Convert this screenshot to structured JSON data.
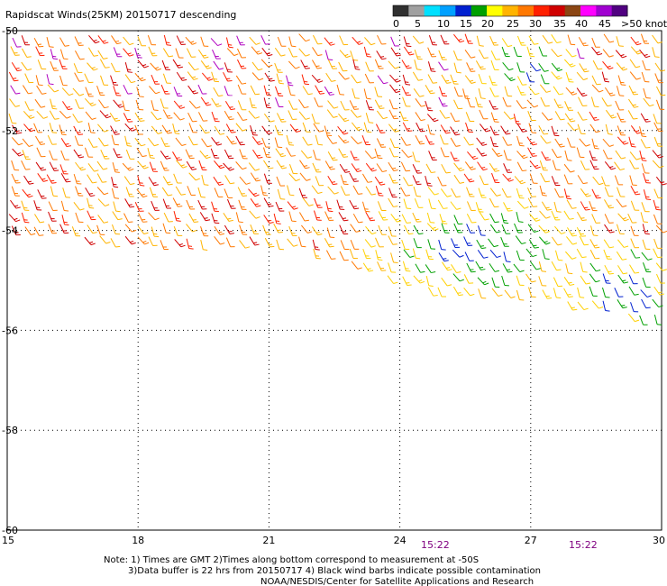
{
  "title": "Rapidscat Winds(25KM) 20150717 descending",
  "legend": {
    "tick_labels": [
      "0",
      "5",
      "10",
      "15",
      "20",
      "25",
      "30",
      "35",
      "40",
      "45",
      ">50 knots"
    ],
    "colors": [
      "#303030",
      "#a0a0a0",
      "#00e0ff",
      "#00a0ff",
      "#0020d0",
      "#00a000",
      "#ffff00",
      "#ffb400",
      "#ff7800",
      "#ff2000",
      "#d00000",
      "#8b4513",
      "#ff00ff",
      "#a000d0",
      "#500080"
    ]
  },
  "axes": {
    "lat_labels": [
      "-50",
      "-52",
      "-54",
      "-56",
      "-58",
      "-60"
    ],
    "lon_labels": [
      "15",
      "18",
      "21",
      "24",
      "27",
      "30"
    ],
    "lat_range": [
      -60,
      -50
    ],
    "lon_range": [
      15,
      30
    ],
    "grid": true
  },
  "time_labels": [
    "15:22",
    "15:22"
  ],
  "notes": [
    "Note: 1) Times are GMT 2)Times along bottom correspond to measurement at -50S",
    "3)Data buffer is 22 hrs from 20150717 4) Black wind barbs indicate possible contamination",
    "NOAA/NESDIS/Center for Satellite Applications and Research"
  ],
  "colors": {
    "background": "#ffffff",
    "grid": "#000000",
    "time_label": "#800080"
  }
}
